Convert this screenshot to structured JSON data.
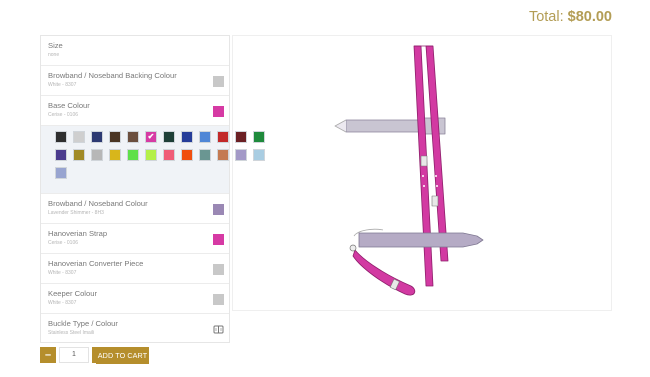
{
  "total": {
    "label": "Total:",
    "amount": "$80.00"
  },
  "options": [
    {
      "label": "Size",
      "sub": "none",
      "swatch": null
    },
    {
      "label": "Browband / Noseband Backing Colour",
      "sub": "White - 8307",
      "swatch": "#c8c8c8"
    },
    {
      "label": "Base Colour",
      "sub": "Cerise - 0106",
      "swatch": "#d63aa4"
    },
    {
      "label": "Browband / Noseband Colour",
      "sub": "Lavender Shimmer - 8H3",
      "swatch": "#9a88b4"
    },
    {
      "label": "Hanoverian Strap",
      "sub": "Cerise - 0106",
      "swatch": "#d63aa4"
    },
    {
      "label": "Hanoverian Converter Piece",
      "sub": "White - 8307",
      "swatch": "#c8c8c8"
    },
    {
      "label": "Keeper Colour",
      "sub": "White - 8307",
      "swatch": "#c8c8c8"
    },
    {
      "label": "Buckle Type / Colour",
      "sub": "Stainless Steel Imaili",
      "swatch": null,
      "icon": "buckle-icon"
    }
  ],
  "palette": {
    "selected_index": 5,
    "selected_mark": "✔",
    "colors": [
      "#2f2f2f",
      "#cfcfcf",
      "#2d3a72",
      "#4a3524",
      "#6b4f3e",
      "#d63aa4",
      "#1e3f37",
      "#253d99",
      "#4f86d6",
      "#c22929",
      "#6b2024",
      "#1f8a3c",
      "#4b3b8e",
      "#a18a26",
      "#b7b7b7",
      "#d8b61b",
      "#5fe04a",
      "#b4f048",
      "#f05c77",
      "#f04e0e",
      "#6a9692",
      "#c47a52",
      "#a399c7",
      "#a9cde2",
      "#98a4d0"
    ]
  },
  "quantity": {
    "minus": "–",
    "value": "1",
    "plus": "+"
  },
  "add_to_cart": "ADD TO CART",
  "colors": {
    "accent": "#b58e2c",
    "total_text": "#b39d55",
    "strap": "#d23aa2",
    "noseband": "#a89db8"
  }
}
